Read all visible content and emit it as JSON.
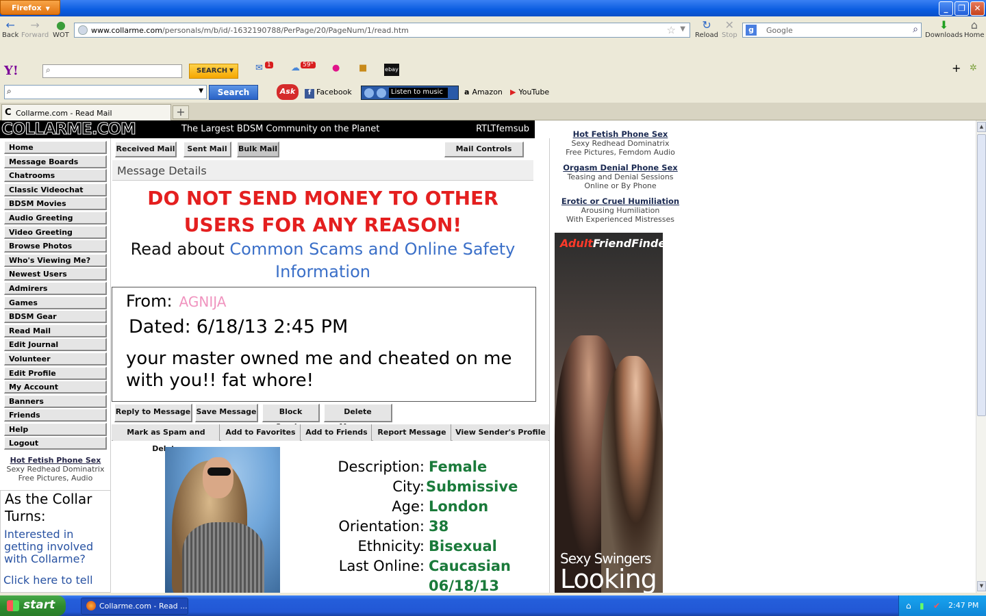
{
  "browser": {
    "menu_button": "Firefox",
    "nav": {
      "back": "Back",
      "forward": "Forward",
      "wot": "WOT",
      "reload": "Reload",
      "stop": "Stop",
      "downloads": "Downloads",
      "home": "Home"
    },
    "url_domain": "www.collarme.com",
    "url_path": "/personals/m/b/id/-1632190788/PerPage/20/PageNum/1/read.htm",
    "search_placeholder": "Google",
    "tab_title": "Collarme.com - Read Mail"
  },
  "yahoo_toolbar": {
    "logo": "Y!",
    "search_button": "SEARCH",
    "mail_badge": "1",
    "weather_badge": "59°",
    "ebay": "ebay"
  },
  "ask_toolbar": {
    "search_button": "Search",
    "ask_logo": "Ask",
    "facebook": "Facebook",
    "music": "Listen to music",
    "amazon": "Amazon",
    "youtube": "YouTube"
  },
  "site": {
    "logo": "COLLARME.COM",
    "tagline": "The Largest BDSM Community on the Planet",
    "username": "RTLTfemsub"
  },
  "left_nav": [
    "Home",
    "Message Boards",
    "Chatrooms",
    "Classic Videochat",
    "BDSM Movies",
    "Audio Greeting",
    "Video Greeting",
    "Browse Photos",
    "Who's Viewing Me?",
    "Newest Users",
    "Admirers",
    "Games",
    "BDSM Gear",
    "Read Mail",
    "Edit Journal",
    "Volunteer",
    "Edit Profile",
    "My Account",
    "Banners",
    "Friends",
    "Help",
    "Logout"
  ],
  "left_ad": {
    "title": "Hot Fetish Phone Sex",
    "line1": "Sexy Redhead Dominatrix",
    "line2": "Free Pictures, Audio"
  },
  "collar_box": {
    "heading": "As the Collar Turns:",
    "body": "Interested in getting involved with Collarme?",
    "link": "Click here to tell"
  },
  "mail_tabs": {
    "received": "Received Mail",
    "sent": "Sent Mail",
    "bulk": "Bulk Mail",
    "controls": "Mail Controls"
  },
  "message": {
    "section_title": "Message Details",
    "warning": "DO NOT SEND MONEY TO OTHER USERS FOR ANY REASON!",
    "read_prefix": "Read about",
    "read_link": "Common Scams and Online Safety Information",
    "from_label": "From:",
    "from_name": "AGNIJA",
    "dated_label": "Dated:",
    "dated_value": "6/18/13 2:45 PM",
    "body": "your master owned me and cheated on me with you!! fat whore!"
  },
  "actions_row1": [
    "Reply to Message",
    "Save Message",
    "Block Sender",
    "Delete Message"
  ],
  "actions_row2": [
    "Mark as Spam and Delete",
    "Add to Favorites",
    "Add to Friends",
    "Report Message",
    "View Sender's Profile"
  ],
  "profile": {
    "labels": [
      "Description:",
      "City:",
      "Age:",
      "Orientation:",
      "Ethnicity:",
      "Last Online:"
    ],
    "values": [
      "Female",
      "Submissive",
      "London",
      "38",
      "Bisexual",
      "Caucasian",
      "06/18/13"
    ]
  },
  "right_ads": [
    {
      "title": "Hot Fetish Phone Sex",
      "line1": "Sexy Redhead Dominatrix",
      "line2": "Free Pictures, Femdom Audio"
    },
    {
      "title": "Orgasm Denial Phone Sex",
      "line1": "Teasing and Denial Sessions",
      "line2": "Online or By Phone"
    },
    {
      "title": "Erotic or Cruel Humiliation",
      "line1": "Arousing Humiliation",
      "line2": "With Experienced Mistresses"
    }
  ],
  "banner": {
    "logo_a": "Adult",
    "logo_b": "FriendFinder",
    "line1": "Sexy Swingers",
    "line2": "Looking"
  },
  "taskbar": {
    "start": "start",
    "window": "Collarme.com - Read ...",
    "clock": "2:47 PM"
  }
}
